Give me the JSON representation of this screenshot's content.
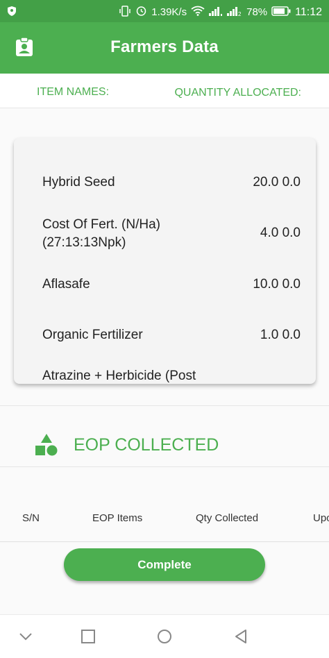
{
  "status_bar": {
    "network_speed": "1.39K/s",
    "battery": "78%",
    "time": "11:12"
  },
  "app_bar": {
    "title": "Farmers Data"
  },
  "header": {
    "left": "ITEM NAMES:",
    "right": "QUANTITY ALLOCATED:"
  },
  "items": [
    {
      "name": "Hybrid Seed",
      "qty": "20.0 0.0"
    },
    {
      "name": "Cost Of Fert. (N/Ha) (27:13:13Npk)",
      "qty": "4.0 0.0"
    },
    {
      "name": "Aflasafe",
      "qty": "10.0 0.0"
    },
    {
      "name": "Organic Fertilizer",
      "qty": "1.0 0.0"
    },
    {
      "name": "Atrazine + Herbicide (Post",
      "qty": ""
    }
  ],
  "eop": {
    "title": "EOP COLLECTED",
    "columns": [
      "S/N",
      "EOP Items",
      "Qty Collected",
      "Upo"
    ]
  },
  "button": {
    "label": "Complete"
  },
  "colors": {
    "accent": "#4caf50",
    "status_bar": "#43a047"
  }
}
